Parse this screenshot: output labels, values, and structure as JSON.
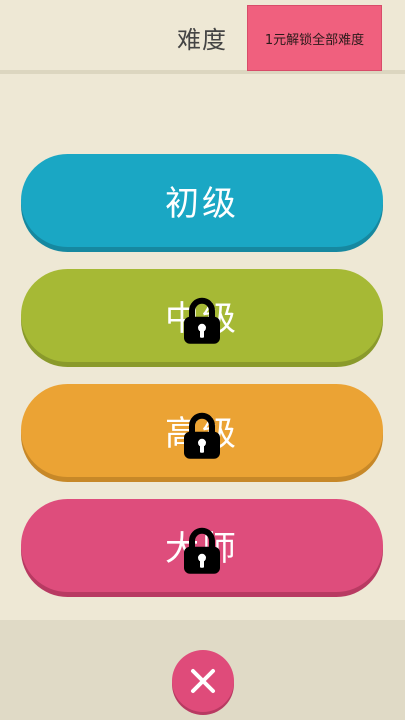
{
  "header": {
    "title": "难度",
    "unlock_label": "1元解锁全部难度"
  },
  "levels": [
    {
      "label": "初级",
      "locked": false,
      "color": "#1aa7c4"
    },
    {
      "label": "中级",
      "locked": true,
      "color": "#a6b935"
    },
    {
      "label": "高级",
      "locked": true,
      "color": "#eba334"
    },
    {
      "label": "大师",
      "locked": true,
      "color": "#de4d7c"
    }
  ],
  "close_icon": "close-icon",
  "colors": {
    "background": "#eee8d5",
    "unlock_button": "#f0607e",
    "close_button": "#df4b7a"
  }
}
